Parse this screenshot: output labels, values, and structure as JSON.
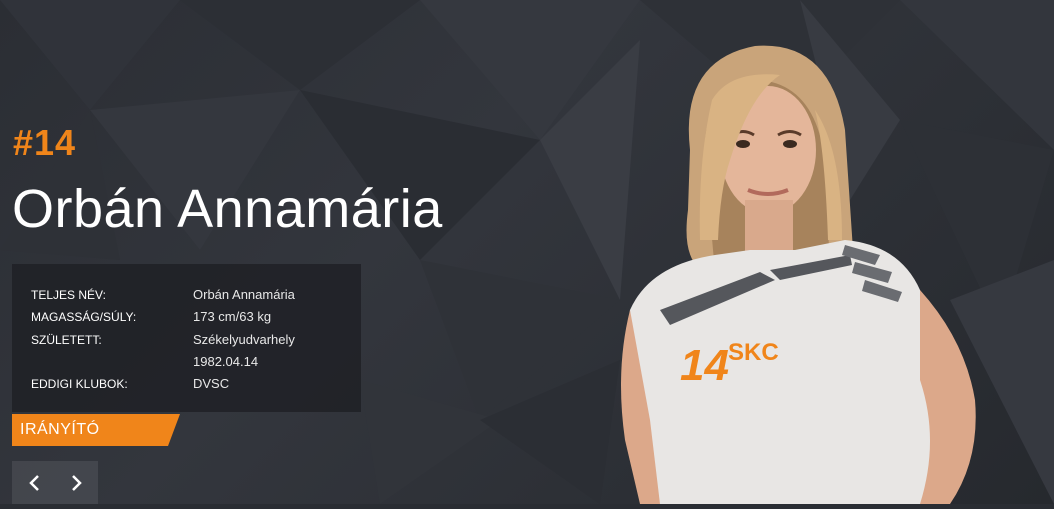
{
  "player": {
    "number": "#14",
    "name": "Orbán Annamária",
    "position": "IRÁNYÍTÓ",
    "jersey_number": "14",
    "jersey_club": "SKC"
  },
  "info": {
    "full_name_label": "TELJES NÉV:",
    "full_name_value": "Orbán Annamária",
    "height_weight_label": "MAGASSÁG/SÚLY:",
    "height_weight_value": "173 cm/63 kg",
    "born_label": "SZÜLETETT:",
    "born_place": "Székelyudvarhely",
    "born_date": "1982.04.14",
    "clubs_label": "EDDIGI KLUBOK:",
    "clubs_value": "DVSC"
  },
  "nav": {
    "prev_icon": "chevron-left-icon",
    "next_icon": "chevron-right-icon"
  },
  "colors": {
    "accent": "#f0851a",
    "background": "#2a2d33",
    "panel": "#1e2024"
  }
}
